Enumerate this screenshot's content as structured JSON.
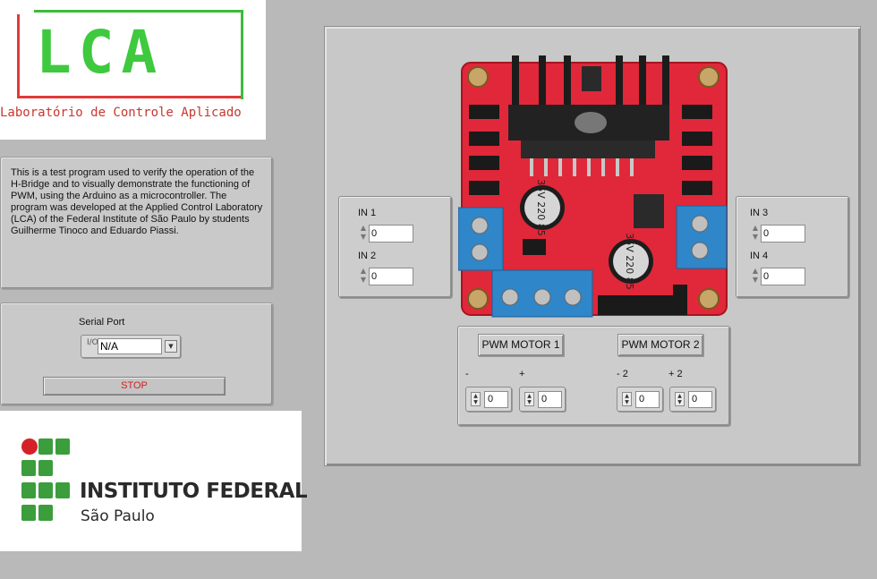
{
  "lca_logo": {
    "letters": "LCA",
    "subtitle": "Laboratório de Controle Aplicado"
  },
  "description": "This is a test program used to verify the operation of the H-Bridge and to visually demonstrate the functioning of PWM, using the Arduino as a microcontroller. The program was developed at the Applied Control Laboratory (LCA) of the Federal Institute of São Paulo by students Guilherme Tinoco and Eduardo Piassi.",
  "serial": {
    "label": "Serial Port",
    "value": "N/A",
    "io_glyph": "I/O"
  },
  "stop_label": "STOP",
  "if_logo": {
    "title": "INSTITUTO FEDERAL",
    "subtitle": "São Paulo"
  },
  "inputs_left": [
    {
      "label": "IN 1",
      "value": "0"
    },
    {
      "label": "IN 2",
      "value": "0"
    }
  ],
  "inputs_right": [
    {
      "label": "IN 3",
      "value": "0"
    },
    {
      "label": "IN 4",
      "value": "0"
    }
  ],
  "pwm": {
    "motor1": {
      "label": "PWM MOTOR 1",
      "minus_label": "-",
      "plus_label": "+",
      "minus_value": "0",
      "plus_value": "0"
    },
    "motor2": {
      "label": "PWM MOTOR 2",
      "minus_label": "- 2",
      "plus_label": "+ 2",
      "minus_value": "0",
      "plus_value": "0"
    }
  },
  "board": {
    "cap_text": "35V 220 85"
  },
  "colors": {
    "background": "#b9b9b9",
    "lca_green": "#3fc93f",
    "lca_red": "#e03a3a",
    "if_green": "#3b9d3b",
    "if_red": "#d32127",
    "stop_text": "#d42020",
    "board_red": "#e0283a",
    "terminal_blue": "#2f86c8"
  }
}
